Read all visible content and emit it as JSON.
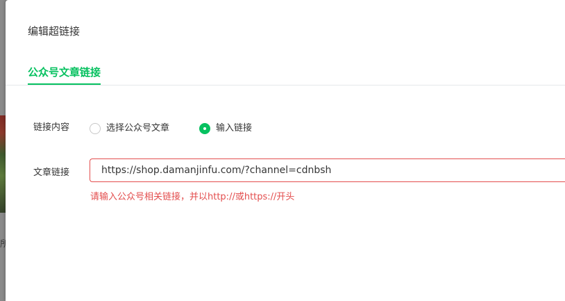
{
  "background": {
    "partial_text": "所"
  },
  "dialog": {
    "title": "编辑超链接",
    "tabs": [
      {
        "label": "公众号文章链接",
        "active": true
      }
    ],
    "form": {
      "link_content": {
        "label": "链接内容",
        "options": [
          {
            "label": "选择公众号文章",
            "checked": false
          },
          {
            "label": "输入链接",
            "checked": true
          }
        ]
      },
      "article_link": {
        "label": "文章链接",
        "value": "https://shop.damanjinfu.com/?channel=cdnbsh",
        "error": "请输入公众号相关链接，并以http://或https://开头"
      }
    }
  },
  "colors": {
    "accent": "#07c160",
    "error": "#e34d4d",
    "text": "#353535"
  }
}
